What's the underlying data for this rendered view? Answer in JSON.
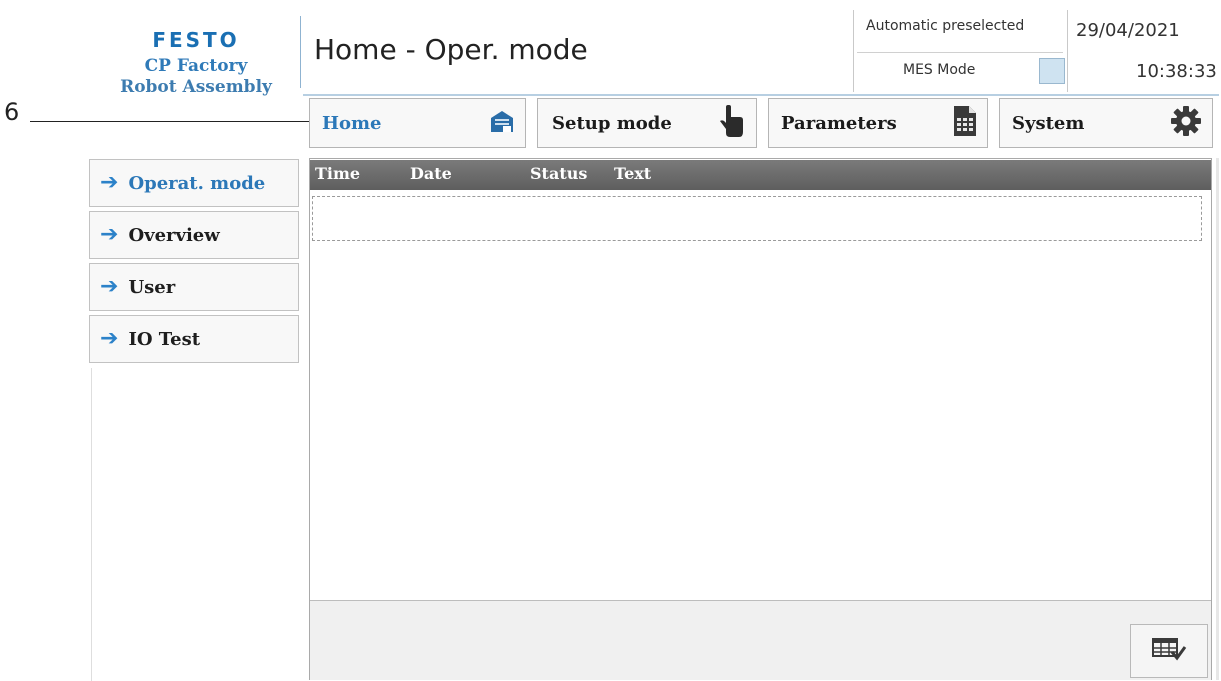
{
  "annotation": {
    "number": "6"
  },
  "logo": {
    "brand": "FESTO",
    "line1": "CP Factory",
    "line2": "Robot Assembly"
  },
  "header": {
    "title": "Home - Oper. mode",
    "status_top": "Automatic preselected",
    "status_bottom": "MES Mode",
    "date": "29/04/2021",
    "time": "10:38:33"
  },
  "tabs": [
    {
      "label": "Home",
      "icon": "home-building-icon",
      "active": true
    },
    {
      "label": "Setup mode",
      "icon": "hand-pointer-icon",
      "active": false
    },
    {
      "label": "Parameters",
      "icon": "document-table-icon",
      "active": false
    },
    {
      "label": "System",
      "icon": "gear-icon",
      "active": false
    }
  ],
  "sidebar": {
    "items": [
      {
        "label": "Operat. mode",
        "icon": "arrow-right-icon",
        "active": true
      },
      {
        "label": "Overview",
        "icon": "arrow-right-icon",
        "active": false
      },
      {
        "label": "User",
        "icon": "arrow-right-icon",
        "active": false
      },
      {
        "label": "IO Test",
        "icon": "arrow-right-icon",
        "active": false
      }
    ]
  },
  "messages": {
    "columns": [
      "Time",
      "Date",
      "Status",
      "Text"
    ],
    "rows": []
  },
  "colors": {
    "accent": "#2c78b8",
    "brand": "#1a6fb3",
    "arrow": "#2c82c9",
    "table_header": "#6a6a6a",
    "mes_indicator": "#cfe3f1"
  }
}
